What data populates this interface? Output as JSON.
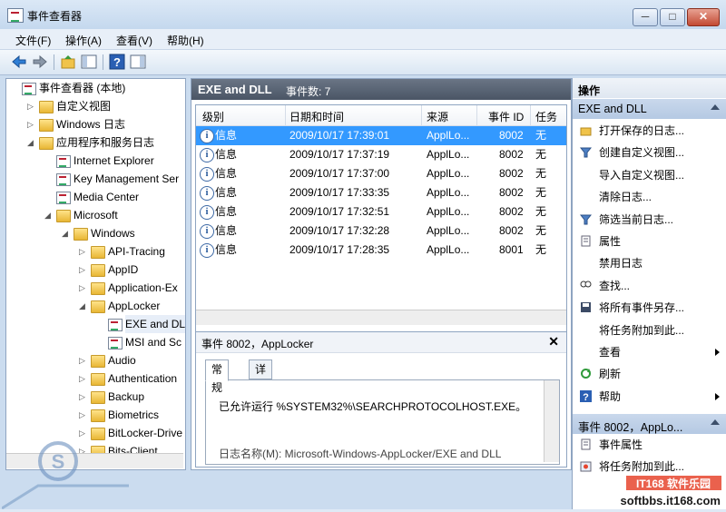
{
  "window": {
    "title": "事件查看器",
    "minimize": "─",
    "maximize": "□",
    "close": "✕"
  },
  "menu": [
    "文件(F)",
    "操作(A)",
    "查看(V)",
    "帮助(H)"
  ],
  "tree": [
    {
      "label": "事件查看器 (本地)",
      "level": 0,
      "icon": "logico",
      "exp": ""
    },
    {
      "label": "自定义视图",
      "level": 1,
      "icon": "folder",
      "exp": "▷"
    },
    {
      "label": "Windows 日志",
      "level": 1,
      "icon": "folder",
      "exp": "▷"
    },
    {
      "label": "应用程序和服务日志",
      "level": 1,
      "icon": "folder",
      "exp": "◢"
    },
    {
      "label": "Internet Explorer",
      "level": 2,
      "icon": "logico",
      "exp": ""
    },
    {
      "label": "Key Management Ser",
      "level": 2,
      "icon": "logico",
      "exp": ""
    },
    {
      "label": "Media Center",
      "level": 2,
      "icon": "logico",
      "exp": ""
    },
    {
      "label": "Microsoft",
      "level": 2,
      "icon": "folder",
      "exp": "◢"
    },
    {
      "label": "Windows",
      "level": 3,
      "icon": "folder",
      "exp": "◢"
    },
    {
      "label": "API-Tracing",
      "level": 4,
      "icon": "folder",
      "exp": "▷"
    },
    {
      "label": "AppID",
      "level": 4,
      "icon": "folder",
      "exp": "▷"
    },
    {
      "label": "Application-Ex",
      "level": 4,
      "icon": "folder",
      "exp": "▷"
    },
    {
      "label": "AppLocker",
      "level": 4,
      "icon": "folder",
      "exp": "◢"
    },
    {
      "label": "EXE and DL",
      "level": 5,
      "icon": "logico",
      "exp": "",
      "selected": true
    },
    {
      "label": "MSI and Sc",
      "level": 5,
      "icon": "logico",
      "exp": ""
    },
    {
      "label": "Audio",
      "level": 4,
      "icon": "folder",
      "exp": "▷"
    },
    {
      "label": "Authentication",
      "level": 4,
      "icon": "folder",
      "exp": "▷"
    },
    {
      "label": "Backup",
      "level": 4,
      "icon": "folder",
      "exp": "▷"
    },
    {
      "label": "Biometrics",
      "level": 4,
      "icon": "folder",
      "exp": "▷"
    },
    {
      "label": "BitLocker-Drive",
      "level": 4,
      "icon": "folder",
      "exp": "▷"
    },
    {
      "label": "Bits-Client",
      "level": 4,
      "icon": "folder",
      "exp": "▷"
    }
  ],
  "main": {
    "header_title": "EXE and DLL",
    "header_count": "事件数: 7",
    "columns": [
      "级别",
      "日期和时间",
      "来源",
      "事件 ID",
      "任务类"
    ],
    "rows": [
      {
        "level": "信息",
        "datetime": "2009/10/17 17:39:01",
        "source": "ApplLo...",
        "id": "8002",
        "task": "无",
        "selected": true
      },
      {
        "level": "信息",
        "datetime": "2009/10/17 17:37:19",
        "source": "ApplLo...",
        "id": "8002",
        "task": "无"
      },
      {
        "level": "信息",
        "datetime": "2009/10/17 17:37:00",
        "source": "ApplLo...",
        "id": "8002",
        "task": "无"
      },
      {
        "level": "信息",
        "datetime": "2009/10/17 17:33:35",
        "source": "ApplLo...",
        "id": "8002",
        "task": "无"
      },
      {
        "level": "信息",
        "datetime": "2009/10/17 17:32:51",
        "source": "ApplLo...",
        "id": "8002",
        "task": "无"
      },
      {
        "level": "信息",
        "datetime": "2009/10/17 17:32:28",
        "source": "ApplLo...",
        "id": "8002",
        "task": "无"
      },
      {
        "level": "信息",
        "datetime": "2009/10/17 17:28:35",
        "source": "ApplLo...",
        "id": "8001",
        "task": "无"
      }
    ],
    "detail": {
      "title": "事件 8002，AppLocker",
      "close": "✕",
      "tabs": [
        "常规",
        "详细信息"
      ],
      "message": "已允许运行 %SYSTEM32%\\SEARCHPROTOCOLHOST.EXE。",
      "field": "日志名称(M):    Microsoft-Windows-AppLocker/EXE and DLL"
    }
  },
  "actions": {
    "header": "操作",
    "section1": "EXE and DLL",
    "items1": [
      {
        "label": "打开保存的日志...",
        "icon": "open-log-icon"
      },
      {
        "label": "创建自定义视图...",
        "icon": "filter-create-icon"
      },
      {
        "label": "导入自定义视图...",
        "icon": ""
      },
      {
        "label": "清除日志...",
        "icon": ""
      },
      {
        "label": "筛选当前日志...",
        "icon": "filter-icon"
      },
      {
        "label": "属性",
        "icon": "properties-icon"
      },
      {
        "label": "禁用日志",
        "icon": ""
      },
      {
        "label": "查找...",
        "icon": "find-icon"
      },
      {
        "label": "将所有事件另存...",
        "icon": "save-icon"
      },
      {
        "label": "将任务附加到此...",
        "icon": ""
      },
      {
        "label": "查看",
        "icon": "",
        "submenu": true
      },
      {
        "label": "刷新",
        "icon": "refresh-icon"
      },
      {
        "label": "帮助",
        "icon": "help-icon",
        "submenu": true
      }
    ],
    "section2": "事件 8002，AppLo...",
    "items2": [
      {
        "label": "事件属性",
        "icon": "event-properties-icon"
      },
      {
        "label": "将任务附加到此...",
        "icon": "attach-task-icon"
      }
    ]
  },
  "watermark": {
    "left": "S",
    "site": "softbbs.it168.com",
    "brand": "IT168 软件乐园"
  }
}
